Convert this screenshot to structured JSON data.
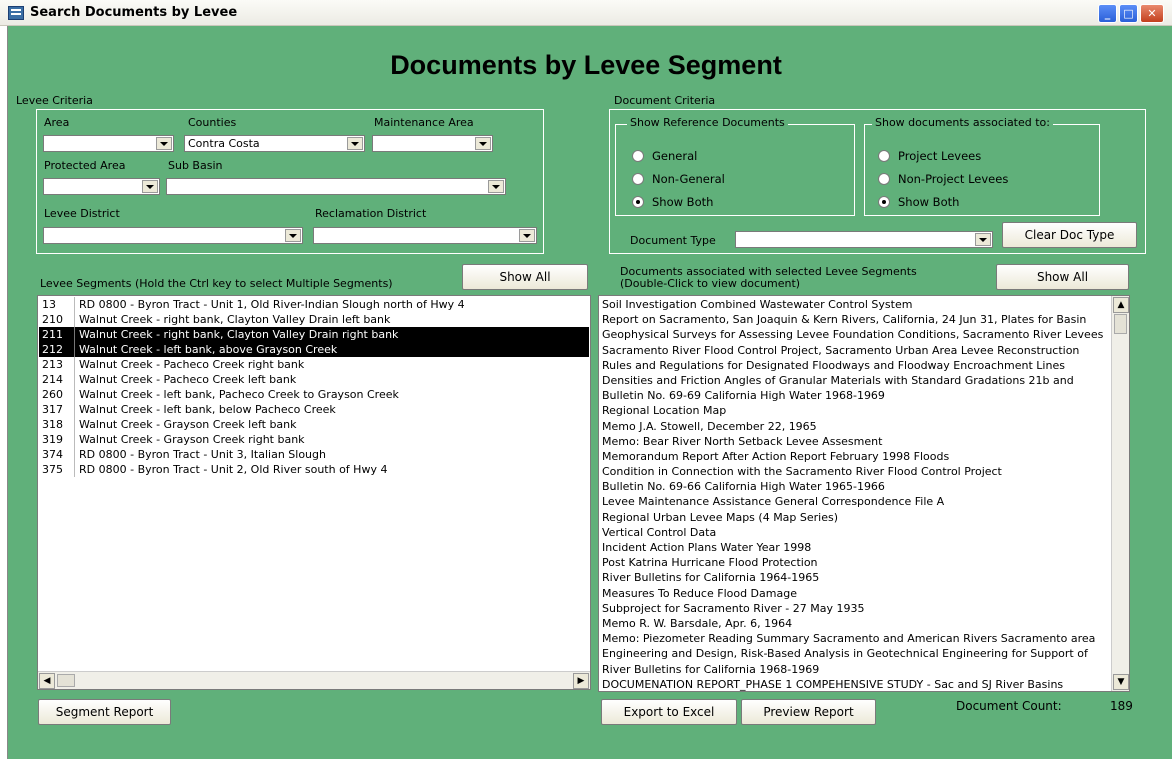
{
  "window": {
    "title": "Search Documents by Levee",
    "min": "_",
    "max": "□",
    "close": "✕"
  },
  "heading": "Documents by Levee Segment",
  "levee_criteria": {
    "title": "Levee Criteria",
    "area_label": "Area",
    "area_value": "",
    "counties_label": "Counties",
    "counties_value": "Contra Costa",
    "maintenance_label": "Maintenance Area",
    "maintenance_value": "",
    "protected_label": "Protected Area",
    "protected_value": "",
    "subbasin_label": "Sub Basin",
    "subbasin_value": "",
    "district_label": "Levee District",
    "district_value": "",
    "reclamation_label": "Reclamation District",
    "reclamation_value": ""
  },
  "document_criteria": {
    "title": "Document Criteria",
    "reference": {
      "title": "Show Reference Documents",
      "options": [
        "General",
        "Non-General",
        "Show Both"
      ],
      "selected": "Show Both"
    },
    "associated": {
      "title": "Show documents associated to:",
      "options": [
        "Project Levees",
        "Non-Project Levees",
        "Show Both"
      ],
      "selected": "Show Both"
    },
    "doc_type_label": "Document Type",
    "doc_type_value": "",
    "clear_button": "Clear Doc Type"
  },
  "segments": {
    "label": "Levee Segments  (Hold the Ctrl key to select Multiple Segments)",
    "show_all": "Show All",
    "rows": [
      {
        "id": "13",
        "name": "RD 0800 - Byron Tract - Unit 1, Old River-Indian Slough north of Hwy 4",
        "selected": false
      },
      {
        "id": "210",
        "name": "Walnut Creek - right bank, Clayton Valley Drain left bank",
        "selected": false
      },
      {
        "id": "211",
        "name": "Walnut Creek - right bank, Clayton Valley Drain right bank",
        "selected": true
      },
      {
        "id": "212",
        "name": "Walnut Creek - left bank, above Grayson Creek",
        "selected": true
      },
      {
        "id": "213",
        "name": "Walnut Creek - Pacheco Creek right bank",
        "selected": false
      },
      {
        "id": "214",
        "name": "Walnut Creek - Pacheco Creek left bank",
        "selected": false
      },
      {
        "id": "260",
        "name": "Walnut Creek - left bank,  Pacheco Creek to Grayson Creek",
        "selected": false
      },
      {
        "id": "317",
        "name": "Walnut Creek - left bank, below Pacheco Creek",
        "selected": false
      },
      {
        "id": "318",
        "name": "Walnut Creek - Grayson Creek left bank",
        "selected": false
      },
      {
        "id": "319",
        "name": "Walnut Creek - Grayson Creek right bank",
        "selected": false
      },
      {
        "id": "374",
        "name": "RD 0800 - Byron Tract - Unit 3, Italian Slough",
        "selected": false
      },
      {
        "id": "375",
        "name": "RD 0800 - Byron Tract - Unit 2, Old River south of Hwy 4",
        "selected": false
      }
    ],
    "report_button": "Segment Report"
  },
  "documents": {
    "label_line1": "Documents associated with selected Levee Segments",
    "label_line2": "(Double-Click to view document)",
    "show_all": "Show All",
    "rows": [
      "Soil Investigation Combined Wastewater Control System",
      "Report on Sacramento, San Joaquin & Kern Rivers, California, 24 Jun 31, Plates for Basin",
      "Geophysical Surveys for Assessing Levee Foundation Conditions, Sacramento River Levees",
      "Sacramento River Flood Control Project, Sacramento Urban Area Levee Reconstruction",
      "Rules and Regulations for Designated Floodways and Floodway Encroachment Lines",
      "Densities and Friction Angles of Granular Materials with Standard Gradations 21b and",
      "Bulletin No. 69-69 California High Water 1968-1969",
      "Regional Location Map",
      "Memo J.A. Stowell, December 22, 1965",
      "Memo: Bear River North Setback Levee Assesment",
      "Memorandum Report After Action Report February 1998 Floods",
      "Condition in Connection with the Sacramento River Flood Control Project",
      "Bulletin No. 69-66 California High Water 1965-1966",
      "Levee Maintenance Assistance General Correspondence File A",
      "Regional Urban Levee Maps (4 Map Series)",
      "Vertical Control Data",
      "Incident Action Plans Water Year 1998",
      "Post Katrina Hurricane Flood Protection",
      "River Bulletins for California 1964-1965",
      "Measures To Reduce Flood Damage",
      "Subproject for Sacramento River - 27 May 1935",
      "Memo R. W. Barsdale, Apr. 6, 1964",
      "Memo: Piezometer Reading Summary Sacramento and American Rivers Sacramento area",
      "Engineering and Design, Risk-Based Analysis in Geotechnical Engineering for Support of",
      "River Bulletins for California 1968-1969",
      "DOCUMENATION REPORT_PHASE 1 COMPEHENSIVE STUDY - Sac and SJ River Basins"
    ],
    "export_button": "Export to Excel",
    "preview_button": "Preview Report",
    "count_label": "Document Count:",
    "count_value": "189"
  }
}
